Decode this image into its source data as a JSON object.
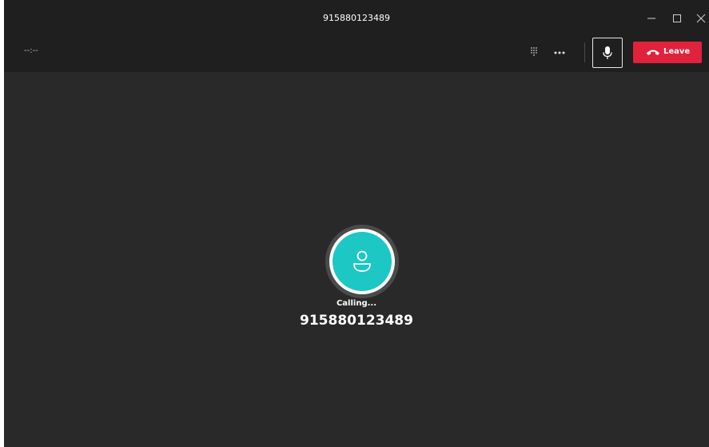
{
  "window": {
    "title": "915880123489"
  },
  "toolbar": {
    "timer": "--:--",
    "leave_label": "Leave",
    "icons": {
      "dialpad": "dialpad-icon",
      "more": "more-options-icon",
      "mic": "microphone-icon",
      "hangup": "hang-up-icon"
    }
  },
  "call": {
    "status": "Calling...",
    "number": "915880123489"
  },
  "colors": {
    "background": "#292929",
    "titlebar": "#1f1f1f",
    "leave_button": "#e0223d",
    "avatar": "#1cc7c4",
    "text": "#ffffff"
  }
}
